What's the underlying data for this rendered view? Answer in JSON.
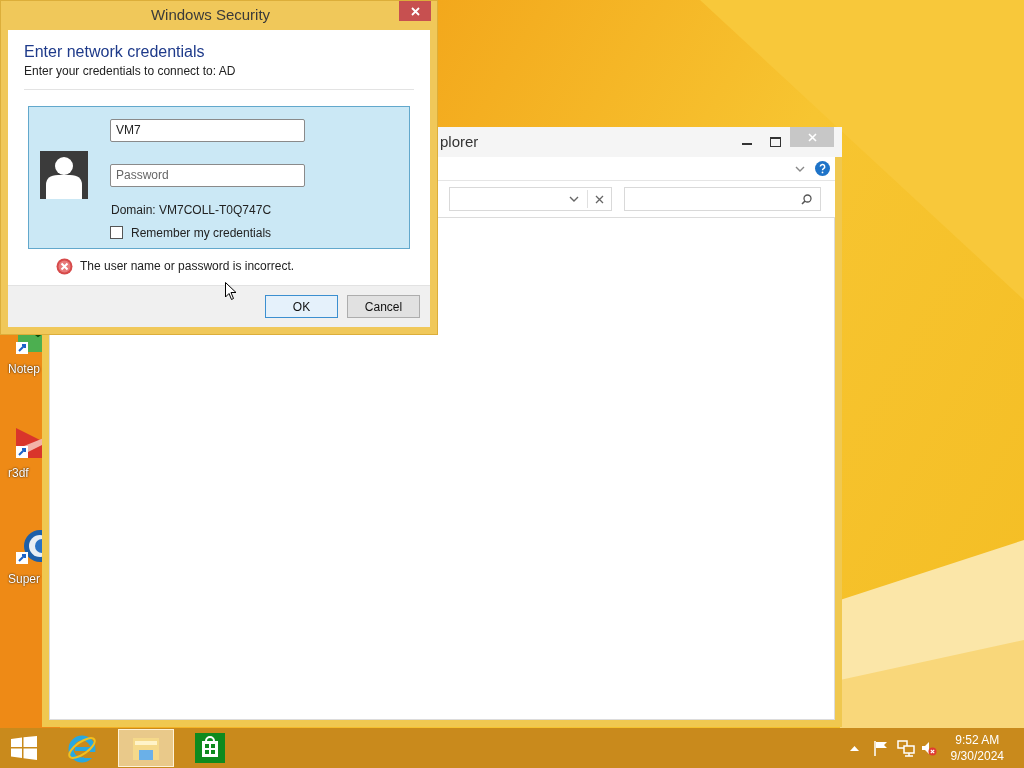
{
  "dialog": {
    "title": "Windows Security",
    "heading": "Enter network credentials",
    "subheading": "Enter your credentials to connect to: AD",
    "username": {
      "value": "VM7"
    },
    "password": {
      "placeholder": "Password"
    },
    "domain": "Domain: VM7COLL-T0Q747C",
    "remember": {
      "label": "Remember my credentials",
      "checked": false
    },
    "error": "The user name or password is incorrect.",
    "buttons": [
      {
        "label": "OK",
        "default": true
      },
      {
        "label": "Cancel",
        "default": false
      }
    ]
  },
  "explorer": {
    "title": "plorer"
  },
  "desktop_icons": [
    {
      "kind": "notepad",
      "label": "Notep"
    },
    {
      "kind": "slides",
      "label": "r3df"
    },
    {
      "kind": "globe",
      "label": "Super"
    }
  ],
  "taskbar": {
    "apps": [
      {
        "kind": "ie",
        "selected": false
      },
      {
        "kind": "explorer",
        "selected": true
      },
      {
        "kind": "store",
        "selected": false
      }
    ],
    "time": "9:52 AM",
    "date": "9/30/2024"
  }
}
